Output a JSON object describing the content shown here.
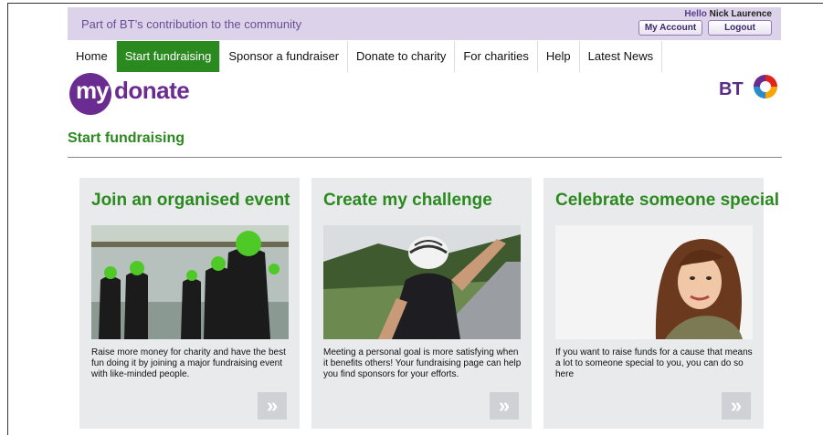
{
  "header": {
    "community_text": "Part of BT’s contribution to the community",
    "hello_prefix": "Hello",
    "user_name": "Nick Laurence",
    "my_account_label": "My Account",
    "logout_label": "Logout"
  },
  "nav": {
    "items": [
      {
        "label": "Home"
      },
      {
        "label": "Start fundraising",
        "active": true
      },
      {
        "label": "Sponsor a fundraiser"
      },
      {
        "label": "Donate to charity"
      },
      {
        "label": "For charities"
      },
      {
        "label": "Help"
      },
      {
        "label": "Latest News"
      }
    ]
  },
  "logo": {
    "my": "my",
    "donate": "donate",
    "bt": "BT"
  },
  "page": {
    "title": "Start fundraising"
  },
  "cards": [
    {
      "title": "Join an organised event",
      "description": "Raise more money for charity and have the best fun doing it by joining a major fundraising event with like-minded people.",
      "icon": "double-chevron-right-icon"
    },
    {
      "title": "Create my challenge",
      "description": "Meeting a personal goal is more satisfying when it benefits others! Your fundraising page can help you find sponsors for your efforts.",
      "icon": "double-chevron-right-icon"
    },
    {
      "title": "Celebrate someone special",
      "description": "If you want to raise funds for a cause that means a lot to someone special to you, you can do so here",
      "icon": "double-chevron-right-icon"
    }
  ],
  "colors": {
    "brand_purple": "#6a2c91",
    "accent_green": "#2b8a1f",
    "topbar_bg": "#dcd3ea"
  }
}
